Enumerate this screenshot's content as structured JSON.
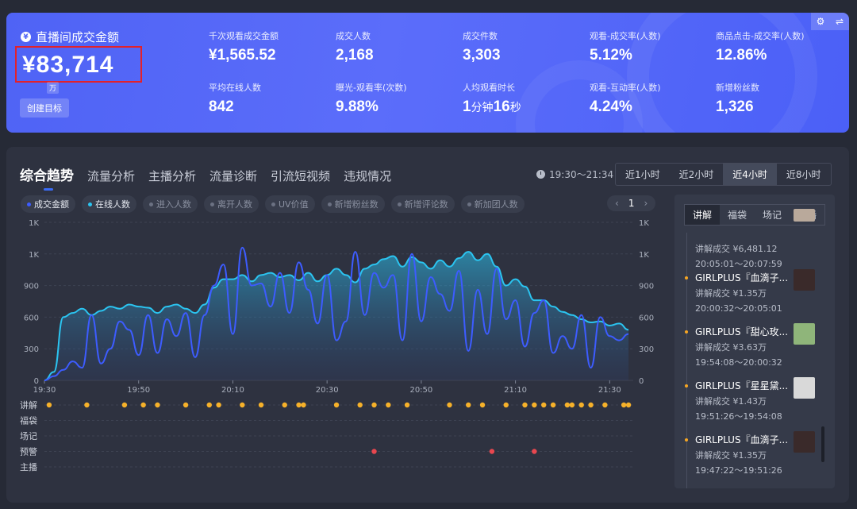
{
  "header": {
    "gmv_title": "直播间成交金额",
    "gmv_value": "¥83,714",
    "gmv_unit": "万",
    "create_goal": "创建目标",
    "metrics": [
      {
        "label": "千次观看成交金额",
        "value": "¥1,565.52",
        "unit": ""
      },
      {
        "label": "成交人数",
        "value": "2,168",
        "unit": ""
      },
      {
        "label": "成交件数",
        "value": "3,303",
        "unit": ""
      },
      {
        "label": "观看-成交率(人数)",
        "value": "5.12%",
        "unit": ""
      },
      {
        "label": "商品点击-成交率(人数)",
        "value": "12.86%",
        "unit": ""
      },
      {
        "label": "平均在线人数",
        "value": "842",
        "unit": ""
      },
      {
        "label": "曝光-观看率(次数)",
        "value": "9.88%",
        "unit": ""
      },
      {
        "label": "人均观看时长",
        "value": "1",
        "unit": "分钟",
        "value2": "16",
        "unit2": "秒"
      },
      {
        "label": "观看-互动率(人数)",
        "value": "4.24%",
        "unit": ""
      },
      {
        "label": "新增粉丝数",
        "value": "1,326",
        "unit": ""
      }
    ]
  },
  "panel": {
    "tabs": [
      "综合趋势",
      "流量分析",
      "主播分析",
      "流量诊断",
      "引流短视频",
      "违规情况"
    ],
    "time_range": "19:30～21:34",
    "periods": [
      "近1小时",
      "近2小时",
      "近4小时",
      "近8小时"
    ],
    "active_period": 2,
    "legend": [
      {
        "label": "成交金额",
        "color": "#3d5cff",
        "on": true
      },
      {
        "label": "在线人数",
        "color": "#2bc4f0",
        "on": true
      },
      {
        "label": "进入人数",
        "on": false
      },
      {
        "label": "离开人数",
        "on": false
      },
      {
        "label": "UV价值",
        "on": false
      },
      {
        "label": "新增粉丝数",
        "on": false
      },
      {
        "label": "新增评论数",
        "on": false
      },
      {
        "label": "新加团人数",
        "on": false
      }
    ],
    "pager": {
      "prev": "‹",
      "page": "1",
      "next": "›"
    }
  },
  "chart_data": {
    "type": "area",
    "x_ticks": [
      "19:30",
      "19:50",
      "20:10",
      "20:30",
      "20:50",
      "21:10",
      "21:30"
    ],
    "y_left_ticks": [
      "0",
      "300",
      "600",
      "900",
      "1K",
      "1K"
    ],
    "y_right_ticks": [
      "0",
      "300",
      "600",
      "900",
      "1K",
      "1K"
    ],
    "ylim": [
      0,
      1500
    ],
    "xlim": [
      0,
      125
    ],
    "series": [
      {
        "name": "在线人数",
        "color": "#2bc4f0",
        "x": [
          0,
          2,
          4,
          6,
          8,
          10,
          12,
          14,
          16,
          18,
          20,
          22,
          24,
          26,
          28,
          30,
          32,
          34,
          36,
          38,
          40,
          42,
          44,
          46,
          48,
          50,
          52,
          54,
          56,
          58,
          60,
          62,
          64,
          66,
          68,
          70,
          72,
          74,
          76,
          78,
          80,
          82,
          84,
          86,
          88,
          90,
          92,
          94,
          96,
          98,
          100,
          102,
          104,
          106,
          108,
          110,
          112,
          114,
          116,
          118,
          120,
          122,
          124
        ],
        "y": [
          0,
          80,
          600,
          640,
          680,
          620,
          660,
          700,
          680,
          720,
          700,
          690,
          640,
          700,
          720,
          680,
          640,
          720,
          880,
          960,
          960,
          1000,
          940,
          1000,
          1020,
          980,
          1000,
          950,
          1020,
          940,
          1000,
          1060,
          1000,
          930,
          1060,
          1100,
          1150,
          1180,
          1080,
          1170,
          1120,
          1060,
          1140,
          1080,
          1160,
          1220,
          1140,
          1200,
          1080,
          900,
          960,
          890,
          760,
          760,
          700,
          650,
          620,
          580,
          550,
          560,
          520,
          540,
          480
        ]
      },
      {
        "name": "成交金额",
        "color": "#3d5cff",
        "x": [
          0,
          2,
          4,
          6,
          8,
          10,
          12,
          14,
          16,
          18,
          20,
          22,
          24,
          26,
          28,
          30,
          32,
          34,
          36,
          38,
          40,
          42,
          44,
          46,
          48,
          50,
          52,
          54,
          56,
          58,
          60,
          62,
          64,
          66,
          68,
          70,
          72,
          74,
          76,
          78,
          80,
          82,
          84,
          86,
          88,
          90,
          92,
          94,
          96,
          98,
          100,
          102,
          104,
          106,
          108,
          110,
          112,
          114,
          116,
          118,
          120,
          122,
          124
        ],
        "y": [
          0,
          40,
          100,
          180,
          120,
          620,
          160,
          300,
          560,
          480,
          240,
          620,
          260,
          580,
          420,
          640,
          220,
          620,
          900,
          1100,
          440,
          1260,
          900,
          920,
          700,
          1020,
          640,
          1120,
          860,
          540,
          1000,
          380,
          560,
          1220,
          620,
          1020,
          880,
          1000,
          380,
          1200,
          560,
          980,
          820,
          660,
          1040,
          280,
          860,
          440,
          1060,
          580,
          760,
          320,
          640,
          760,
          260,
          420,
          300,
          620,
          120,
          600,
          420,
          380,
          440
        ]
      }
    ]
  },
  "event_rows": [
    "讲解",
    "福袋",
    "场记",
    "预警",
    "主播"
  ],
  "events": {
    "讲解": [
      1,
      9,
      17,
      21,
      24,
      30,
      35,
      37,
      42,
      46,
      51,
      54,
      55,
      62,
      67,
      70,
      73,
      77,
      86,
      90,
      93,
      98,
      102,
      104,
      106,
      108,
      111,
      112,
      114,
      116,
      119,
      123,
      124
    ],
    "预警": [
      70,
      95,
      104
    ]
  },
  "side": {
    "tabs": [
      "讲解",
      "福袋",
      "场记",
      "主播"
    ],
    "items": [
      {
        "name": "",
        "deal": "讲解成交 ¥6,481.12",
        "time": "20:05:01～20:07:59",
        "thumb": "#b9a99b"
      },
      {
        "name": "GIRLPLUS『血滴子...",
        "deal": "讲解成交 ¥1.35万",
        "time": "20:00:32～20:05:01",
        "thumb": "#3a2a2a"
      },
      {
        "name": "GIRLPLUS『甜心玫...",
        "deal": "讲解成交 ¥3.63万",
        "time": "19:54:08～20:00:32",
        "thumb": "#8fb57a"
      },
      {
        "name": "GIRLPLUS『星星黛...",
        "deal": "讲解成交 ¥1.43万",
        "time": "19:51:26～19:54:08",
        "thumb": "#d9d9d9"
      },
      {
        "name": "GIRLPLUS『血滴子...",
        "deal": "讲解成交 ¥1.35万",
        "time": "19:47:22～19:51:26",
        "thumb": "#3a2a2a"
      }
    ]
  }
}
